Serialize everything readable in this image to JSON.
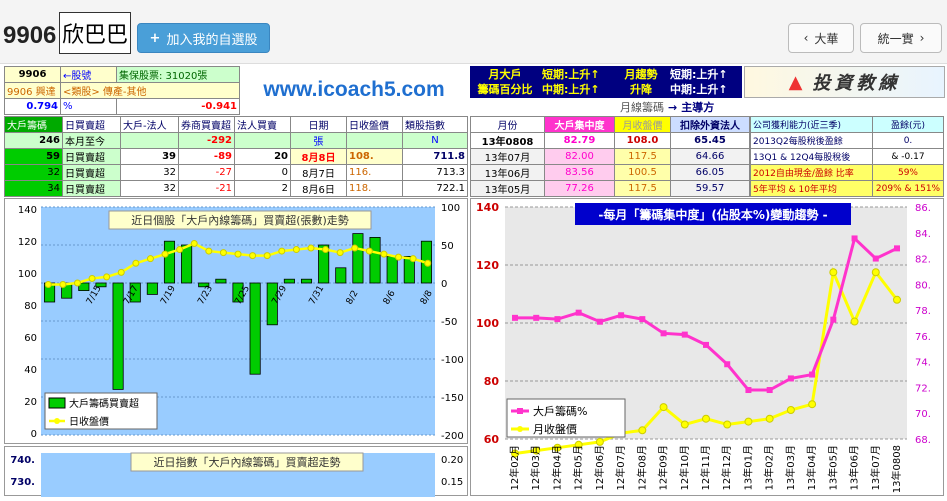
{
  "header": {
    "stock_code": "9906",
    "stock_name": "欣巴巴",
    "add_watchlist_label": "加入我的自選股",
    "market_label": "大華",
    "overview_label": "統一實"
  },
  "info": {
    "code": "9906",
    "code_note": "←股號",
    "pledge": "集保股票: 31020張",
    "exchange_name": "9906 興達",
    "category": "<類股> 傳產-其他",
    "pct_value": "0.794",
    "pct_unit": "%",
    "change": "-0.941"
  },
  "logo": {
    "url": "www.icoach5.com"
  },
  "chips_header": {
    "a1": "月大戶",
    "a2": "籌碼百分比",
    "b1": "短期:上升↑",
    "b2": "中期:上升↑",
    "c1": "月趨勢",
    "c2": "升降",
    "d1": "短期:上升↑",
    "d2": "中期:上升↑",
    "banner": "投資教練",
    "monthly_title": "月線籌碼",
    "arrow": "→",
    "leader": "主導方"
  },
  "daily_table": {
    "headers": [
      "大戶籌碼",
      "日買賣超",
      "大戶-法人",
      "券商買賣超",
      "法人買賣",
      "日期",
      "日收盤價",
      "類股指數"
    ],
    "subrow": [
      "246",
      "本月至今",
      "",
      "-292",
      "",
      "張",
      "",
      "N"
    ],
    "rows": [
      [
        "59",
        "日買賣超",
        "39",
        "-89",
        "20",
        "8月8日",
        "108.",
        "711.8"
      ],
      [
        "32",
        "日買賣超",
        "32",
        "-27",
        "0",
        "8月7日",
        "116.",
        "713.3"
      ],
      [
        "34",
        "日買賣超",
        "32",
        "-21",
        "2",
        "8月6日",
        "118.",
        "722.1"
      ]
    ]
  },
  "monthly_table": {
    "headers": [
      "月份",
      "大戶集中度",
      "月收盤價",
      "扣除外資法人"
    ],
    "rows": [
      [
        "13年0808",
        "82.79",
        "108.0",
        "65.45"
      ],
      [
        "13年07月",
        "82.00",
        "117.5",
        "64.66"
      ],
      [
        "13年06月",
        "83.56",
        "100.5",
        "66.05"
      ],
      [
        "13年05月",
        "77.26",
        "117.5",
        "59.57"
      ]
    ]
  },
  "side_table": {
    "headers": [
      "公司獲利能力(近三季)",
      "盈餘(元)"
    ],
    "rows": [
      [
        "2013Q2每股稅後盈餘",
        "0."
      ],
      [
        "13Q1 & 12Q4每股稅後",
        "& -0.17"
      ],
      [
        "2012自由現金/盈餘 比率",
        "59%"
      ],
      [
        "5年平均 & 10年平均",
        "209% & 151%"
      ]
    ]
  },
  "chart_data": [
    {
      "type": "bar",
      "title": "近日個股「大戶內線籌碼」買賣超(張數)走勢",
      "categories": [
        "7/15",
        "7/17",
        "7/19",
        "7/23",
        "7/25",
        "7/29",
        "7/31",
        "8/2",
        "8/6",
        "8/8"
      ],
      "ylim_left": [
        -200,
        100
      ],
      "ylim_right": [
        -200,
        100
      ],
      "y_left_ticks": [
        "140",
        "120",
        "100",
        "80",
        "60",
        "40",
        "20",
        "0"
      ],
      "y_right_ticks": [
        "100",
        "50",
        "0",
        "-50",
        "-100",
        "-150",
        "-200"
      ],
      "series": [
        {
          "name": "大戶籌碼買賣超",
          "values": [
            -25,
            -20,
            -10,
            -5,
            -140,
            -25,
            -15,
            55,
            50,
            -5,
            5,
            -25,
            -120,
            -55,
            5,
            5,
            50,
            20,
            65,
            60,
            35,
            35,
            55
          ]
        },
        {
          "name": "日收盤價",
          "values": [
            99,
            99,
            100,
            103,
            104,
            107,
            113,
            116,
            119,
            122,
            126,
            121,
            120,
            119,
            118,
            118,
            121,
            122,
            123,
            122,
            120,
            123,
            121,
            119,
            117,
            116,
            113
          ]
        }
      ],
      "grid": true,
      "legend": "bottom-left"
    },
    {
      "type": "line",
      "title": "-每月「籌碼集中度」(佔股本%)變動趨勢 -",
      "categories": [
        "12年02月",
        "12年03月",
        "12年04月",
        "12年05月",
        "12年06月",
        "12年07月",
        "12年08月",
        "12年09月",
        "12年10月",
        "12年11月",
        "12年12月",
        "13年01月",
        "13年02月",
        "13年03月",
        "13年04月",
        "13年05月",
        "13年06月",
        "13年07月",
        "13年0808"
      ],
      "ylim_left": [
        60,
        140
      ],
      "ylim_right": [
        68,
        86
      ],
      "y_left_ticks": [
        "140",
        "120",
        "100",
        "80",
        "60"
      ],
      "y_right_ticks": [
        "86.",
        "84.",
        "82.",
        "80.",
        "78.",
        "76.",
        "74.",
        "72.",
        "70.",
        "68."
      ],
      "series": [
        {
          "name": "大戶籌碼%",
          "values": [
            77.4,
            77.4,
            77.3,
            77.8,
            77.1,
            77.6,
            77.3,
            76.2,
            76.1,
            75.3,
            73.8,
            71.8,
            71.8,
            72.7,
            73.0,
            77.26,
            83.56,
            82.0,
            82.79
          ]
        },
        {
          "name": "月收盤價",
          "values": [
            55,
            56,
            57,
            58,
            59,
            62,
            63,
            71,
            65,
            67,
            65,
            66,
            67,
            70,
            72,
            117.5,
            100.5,
            117.5,
            108.0
          ]
        }
      ],
      "grid": true,
      "legend": "bottom-left"
    },
    {
      "type": "bar",
      "title": "近日指數「大戶內線籌碼」買賣超走勢",
      "y_left_ticks": [
        "740.",
        "730."
      ],
      "y_right_ticks": [
        "0.20",
        "0.15"
      ]
    }
  ],
  "colors": {
    "accent": "#4a9fd8",
    "green": "#00cc00",
    "yellow": "#ffff00",
    "magenta": "#ff33cc",
    "navy": "#000080"
  }
}
